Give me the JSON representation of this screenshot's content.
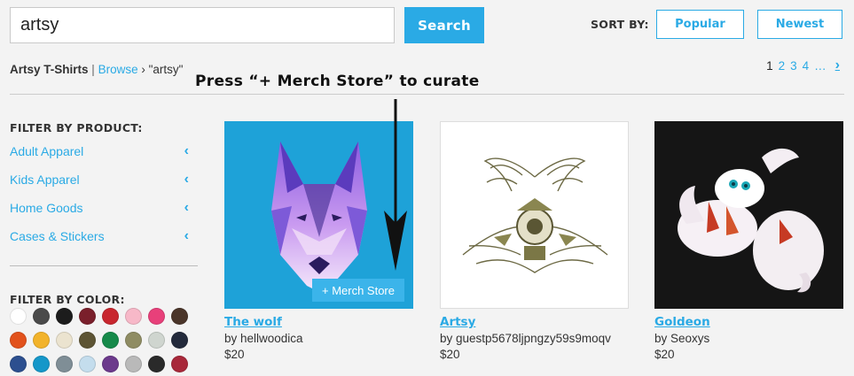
{
  "search": {
    "value": "artsy",
    "button_label": "Search"
  },
  "sort": {
    "label": "SORT BY:",
    "options": [
      "Popular",
      "Newest"
    ]
  },
  "breadcrumb": {
    "title": "Artsy T-Shirts",
    "separator": "|",
    "browse": "Browse",
    "chevron": "›",
    "query": "\"artsy\""
  },
  "pagination": {
    "current": "1",
    "pages": [
      "2",
      "3",
      "4"
    ],
    "ellipsis": "…",
    "next": "›"
  },
  "annotation": {
    "text": "Press “+ Merch Store” to curate"
  },
  "filters": {
    "product_title": "FILTER BY PRODUCT:",
    "product_items": [
      {
        "label": "Adult Apparel",
        "icon": "chevron-left-icon"
      },
      {
        "label": "Kids Apparel",
        "icon": "chevron-left-icon"
      },
      {
        "label": "Home Goods",
        "icon": "chevron-left-icon"
      },
      {
        "label": "Cases & Stickers",
        "icon": "chevron-left-icon"
      }
    ],
    "chevron": "‹",
    "color_title": "FILTER BY COLOR:",
    "colors": [
      "#ffffff",
      "#4a4a4a",
      "#1c1c1c",
      "#7a1f2b",
      "#c8262e",
      "#f7b8c8",
      "#e8407a",
      "#4a3529",
      "#e2521c",
      "#f2b32b",
      "#ebe3cf",
      "#5d5434",
      "#168a4a",
      "#8f8c63",
      "#cfd5cf",
      "#232a3b",
      "#2c4f8f",
      "#1597c9",
      "#7f8e96",
      "#c4dded",
      "#6c3a8c",
      "#b9b9b9",
      "#2a2a2a",
      "#a8283a"
    ]
  },
  "products": [
    {
      "title": "The wolf",
      "artist": "by hellwoodica",
      "price": "$20",
      "bg": "#1ea2d8",
      "merch_label": "+ Merch Store"
    },
    {
      "title": "Artsy",
      "artist": "by guestp5678ljpngzy59s9moqv",
      "price": "$20",
      "bg": "#ffffff"
    },
    {
      "title": "Goldeon",
      "artist": "by Seoxys",
      "price": "$20",
      "bg": "#151515"
    }
  ]
}
